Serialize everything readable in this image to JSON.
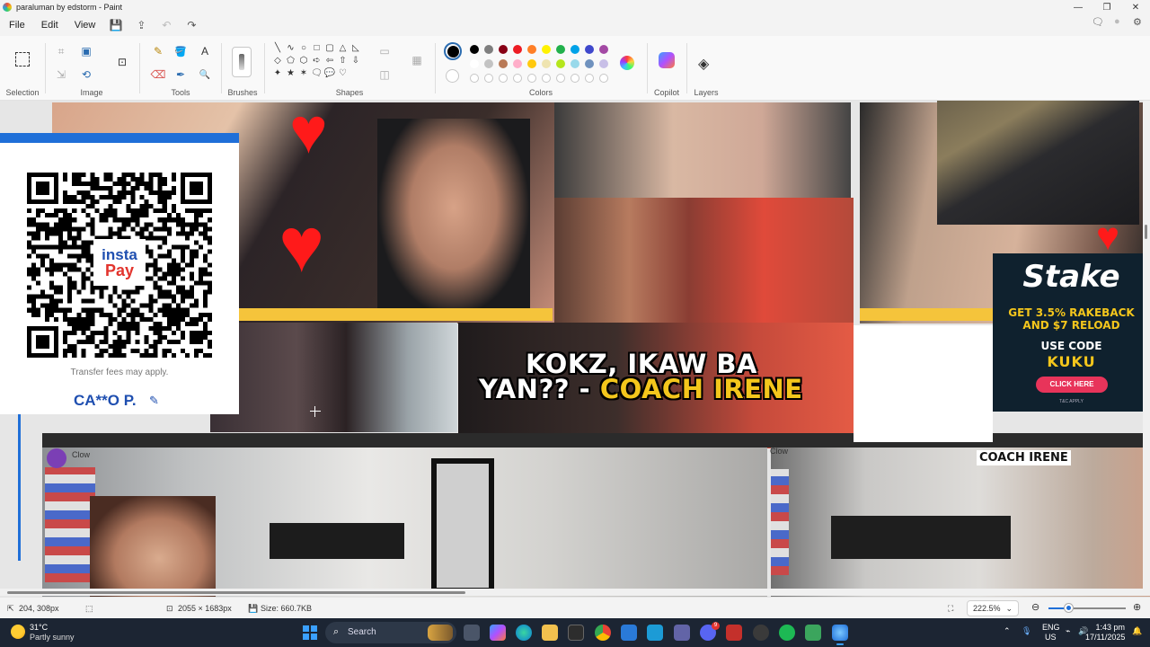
{
  "window": {
    "title": "paraluman by edstorm - Paint",
    "minimize_glyph": "—",
    "maximize_glyph": "❐",
    "close_glyph": "✕"
  },
  "menu": {
    "file": "File",
    "edit": "Edit",
    "view": "View",
    "save_glyph": "💾",
    "share_glyph": "⇪",
    "undo_glyph": "↶",
    "redo_glyph": "↷",
    "comment_glyph": "🗨",
    "account_glyph": "●",
    "settings_glyph": "⚙"
  },
  "ribbon": {
    "groups": {
      "selection": "Selection",
      "image": "Image",
      "tools": "Tools",
      "brushes": "Brushes",
      "shapes": "Shapes",
      "colors": "Colors",
      "copilot": "Copilot",
      "layers": "Layers"
    },
    "icons": {
      "crop": "⌗",
      "resize": "⇲",
      "rotate": "⟲",
      "fill_shape": "▣",
      "image_select": "⊡",
      "remove_bg": "⬚",
      "pencil": "✎",
      "bucket": "🪣",
      "text": "A",
      "eraser": "⌫",
      "picker": "✒",
      "magnifier": "🔍",
      "outline": "▭",
      "fill": "◫",
      "grid": "▦"
    },
    "shapes": [
      "╲",
      "∿",
      "○",
      "□",
      "▢",
      "△",
      "◺",
      "◇",
      "⬠",
      "⬡",
      "➪",
      "⇦",
      "⇧",
      "⇩",
      "✦",
      "★",
      "✶",
      "🗨",
      "💬",
      "♡"
    ],
    "color_row1": [
      "#000000",
      "#7f7f7f",
      "#880015",
      "#ed1c24",
      "#ff7f27",
      "#fff200",
      "#22b14c",
      "#00a2e8",
      "#3f48cc",
      "#a349a4"
    ],
    "color_row2": [
      "#ffffff",
      "#c3c3c3",
      "#b97a57",
      "#ffaec9",
      "#ffc90e",
      "#efe4b0",
      "#b5e61d",
      "#99d9ea",
      "#7092be",
      "#c8bfe7"
    ],
    "primary_color": "#000000",
    "secondary_color": "#ffffff"
  },
  "canvas": {
    "caption_line1": "KOKZ, IKAW BA",
    "caption_line2_white": "YAN?? - ",
    "caption_line2_yellow": "COACH IRENE",
    "coach_label": "COACH IRENE",
    "chat_name": "Clow",
    "chat_name2": "Clow",
    "qr_panel": {
      "logo_line1": "insta",
      "logo_line2": "Pay",
      "fees_note": "Transfer fees may apply.",
      "account_name": "CA**O P.",
      "edit_icon": "✎"
    },
    "stake_ad": {
      "logo": "Stake",
      "promo_line1": "GET 3.5% RAKEBACK",
      "promo_line2": "AND $7 RELOAD",
      "use_code": "USE CODE",
      "code": "KUKU",
      "button": "CLICK HERE",
      "fine_print": "T&C APPLY"
    }
  },
  "statusbar": {
    "cursor_pos": "204, 308px",
    "canvas_size": "2055 × 1683px",
    "file_size": "Size: 660.7KB",
    "zoom": "222.5%",
    "zoom_level_fraction": 0.25
  },
  "taskbar": {
    "temperature": "31°C",
    "weather": "Partly sunny",
    "search_placeholder": "Search",
    "lang_line1": "ENG",
    "lang_line2": "US",
    "time": "1:43 pm",
    "date": "17/11/2025",
    "discord_badge": "9"
  }
}
